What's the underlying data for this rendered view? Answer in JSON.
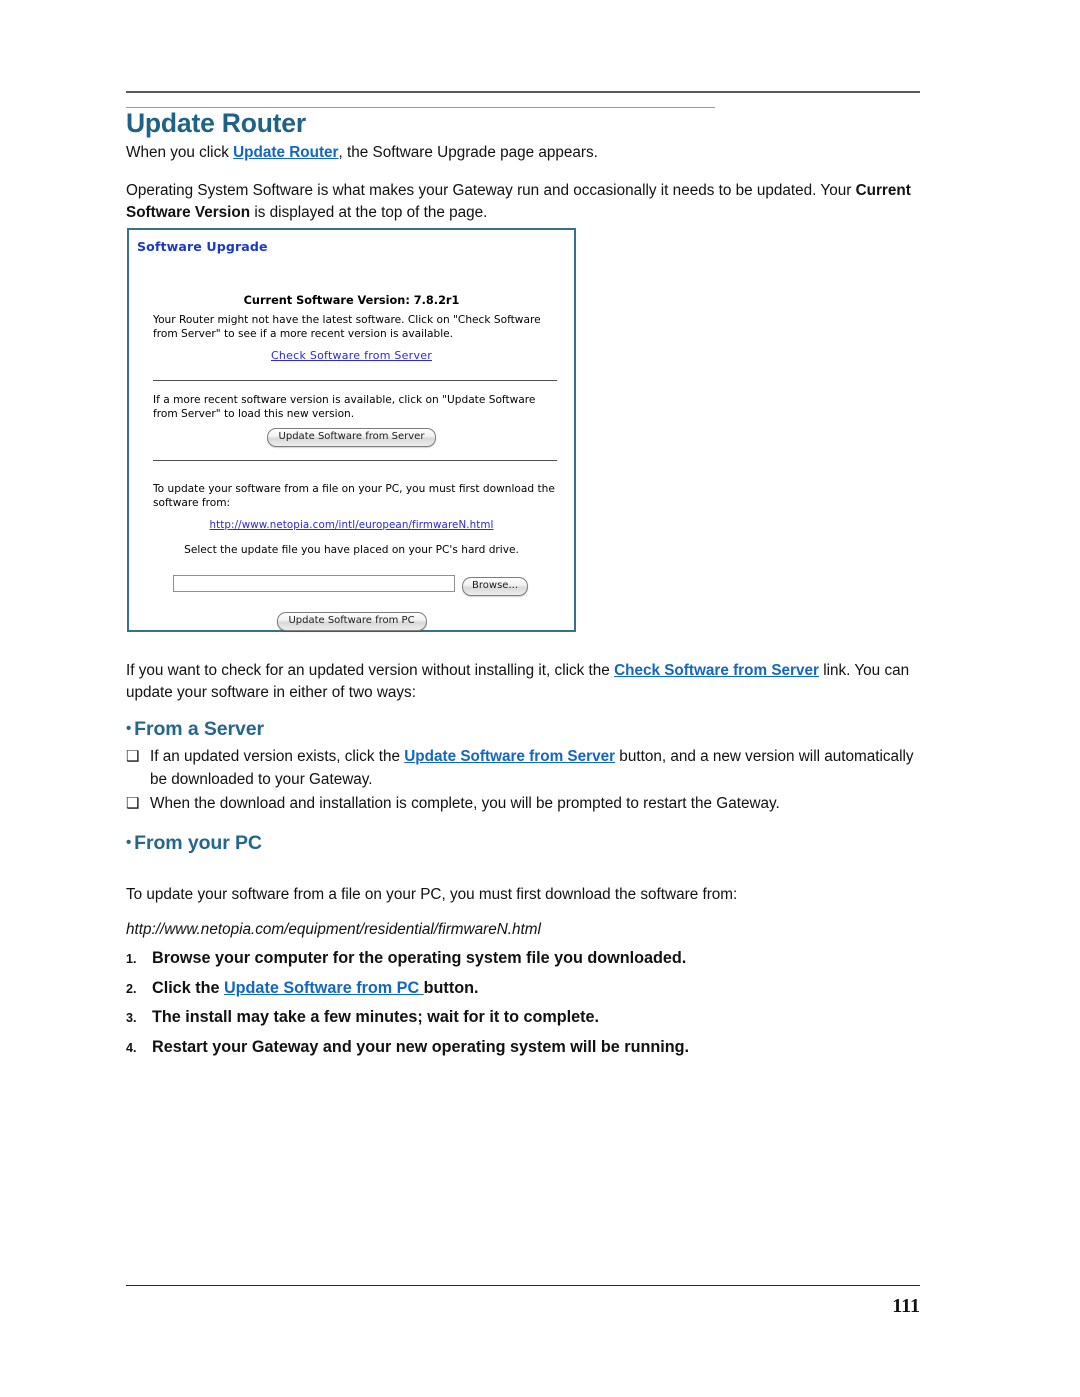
{
  "document": {
    "page_number": "111",
    "title": "Update Router"
  },
  "intro": {
    "line1_before": "When you click ",
    "line1_link": "Update Router",
    "line1_after": ", the Software Upgrade page appears.",
    "para2_before": "Operating System Software is what makes your Gateway run and occasionally it needs to be updated. Your ",
    "para2_bold": "Current Software Version",
    "para2_after": " is displayed at the top of the page."
  },
  "screenshot": {
    "panel_title": "Software Upgrade",
    "version_label": "Current Software Version: 7.8.2r1",
    "paragraph_1": "Your Router might not have the latest software. Click on \"Check Software from Server\" to see if a more recent version is available.",
    "check_link": "Check Software from Server",
    "paragraph_2": "If a more recent software version is available, click on \"Update Software from Server\" to load this new version.",
    "update_server_button": "Update Software from Server",
    "paragraph_3": "To update your software from a file on your PC, you must first download the software from:",
    "download_url": "http://www.netopia.com/intl/european/firmwareN.html",
    "select_file_label": "Select the update  file you have placed on your PC's hard drive.",
    "file_input_value": "",
    "browse_button": "Browse...",
    "update_pc_button": "Update Software from PC"
  },
  "after_shot": {
    "p3_before": "If you want to check for an updated version without installing it, click the ",
    "p3_link": "Check Software from Server",
    "p3_after": " link. You can update your software in either of two ways:"
  },
  "from_server": {
    "bullet_glyph": "❑",
    "heading_dot": "•",
    "heading": "From a Server",
    "items": [
      {
        "before": "If an updated version exists, click the ",
        "link": "Update Software from Server",
        "after": " button, and a new version will automatically be downloaded to your Gateway."
      },
      {
        "before": "When the download and installation is complete, you will be prompted to restart the Gateway.",
        "link": "",
        "after": ""
      }
    ]
  },
  "from_pc": {
    "heading_dot": "•",
    "heading": "From your PC",
    "paragraph": "To update your software from a file on your PC, you must first download the software from:",
    "url": "http://www.netopia.com/equipment/residential/firmwareN.html",
    "steps": [
      {
        "number": "1.",
        "before": "Browse your computer for the operating system file you downloaded.",
        "link": "",
        "after": ""
      },
      {
        "number": "2.",
        "before": "Click the ",
        "link": "Update Software from PC ",
        "after": "button."
      },
      {
        "number": "3.",
        "before": "The install may take a few minutes; wait for it to complete.",
        "link": "",
        "after": ""
      },
      {
        "number": "4.",
        "before": "Restart your Gateway and your new operating system will be running.",
        "link": "",
        "after": ""
      }
    ]
  },
  "colors": {
    "heading_blue": "#1f6288",
    "section_blue": "#25668c",
    "link_blue": "#1267c0",
    "panel_border": "#35708f",
    "panel_title_blue": "#1b39c9",
    "panel_link_blue": "#2b2bd0"
  }
}
